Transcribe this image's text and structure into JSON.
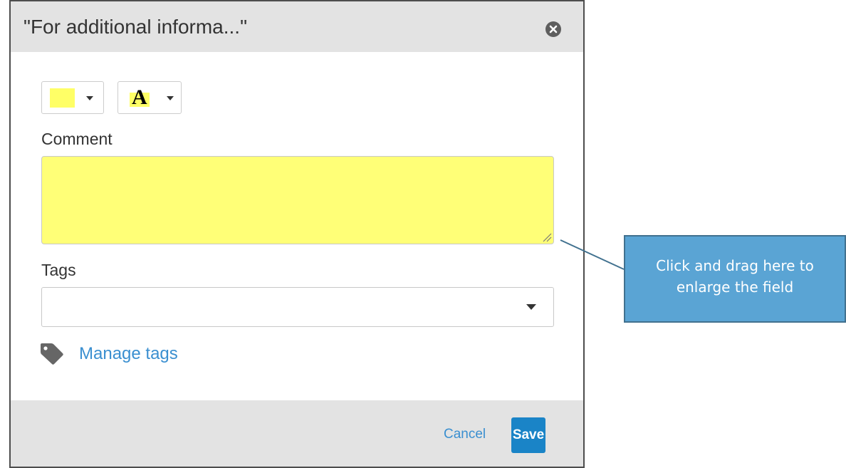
{
  "dialog": {
    "title": "\"For additional informa...\"",
    "close_icon": "close-circle-icon",
    "color_picker": {
      "swatch_color": "#ffff66",
      "icon": "chevron-down-icon"
    },
    "text_style_picker": {
      "glyph": "A",
      "highlight_color": "#ffff66",
      "icon": "chevron-down-icon"
    },
    "comment": {
      "label": "Comment",
      "value": "",
      "background": "#ffff77"
    },
    "tags": {
      "label": "Tags",
      "value": ""
    },
    "manage_tags": {
      "icon": "tag-icon",
      "label": "Manage tags"
    },
    "footer": {
      "cancel_label": "Cancel",
      "save_label": "Save"
    }
  },
  "callout": {
    "line1": "Click and drag here to",
    "line2": "enlarge the field"
  },
  "colors": {
    "header_bg": "#e3e3e3",
    "link": "#3a8fd0",
    "primary": "#1a84c7",
    "callout_bg": "#5aa4d4"
  }
}
